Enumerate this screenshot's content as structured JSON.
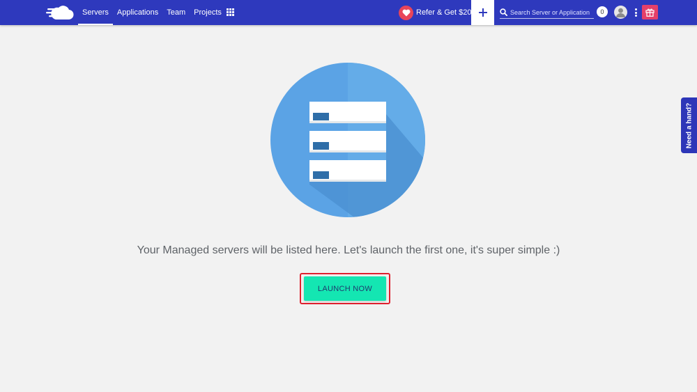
{
  "header": {
    "nav": [
      {
        "label": "Servers",
        "active": true
      },
      {
        "label": "Applications",
        "active": false
      },
      {
        "label": "Team",
        "active": false
      },
      {
        "label": "Projects",
        "active": false
      }
    ],
    "refer_label": "Refer & Get $20",
    "search_placeholder": "Search Server or Application",
    "notification_count": "0"
  },
  "main": {
    "message": "Your Managed servers will be listed here. Let's launch the first one, it's super simple :)",
    "launch_label": "LAUNCH NOW"
  },
  "help": {
    "label": "Need a hand?"
  },
  "icons": {
    "logo": "cloud-logo-icon",
    "apps": "grid-icon",
    "refer": "heart-icon",
    "add": "plus-icon",
    "search": "search-icon",
    "user": "user-icon",
    "menu": "kebab-menu-icon",
    "gift": "gift-icon",
    "illustration": "server-stack-icon"
  },
  "colors": {
    "header": "#2e39bd",
    "accent": "#14e6b2",
    "heart": "#e8455a",
    "gift": "#e5406a",
    "illustration_bg": "#5ba3e5"
  }
}
